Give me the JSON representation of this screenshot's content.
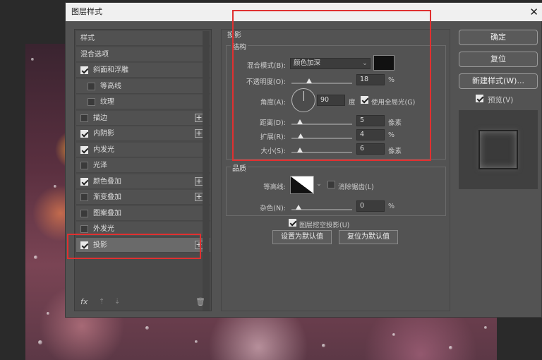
{
  "dialog": {
    "title": "图层样式",
    "close_symbol": "✕"
  },
  "left_panel": {
    "items": [
      {
        "label": "样式",
        "checkbox": false,
        "checked": false,
        "sub": false,
        "plus": false,
        "selected": false
      },
      {
        "label": "混合选项",
        "checkbox": false,
        "checked": false,
        "sub": false,
        "plus": false,
        "selected": false
      },
      {
        "label": "斜面和浮雕",
        "checkbox": true,
        "checked": true,
        "sub": false,
        "plus": false,
        "selected": false
      },
      {
        "label": "等高线",
        "checkbox": true,
        "checked": false,
        "sub": true,
        "plus": false,
        "selected": false
      },
      {
        "label": "纹理",
        "checkbox": true,
        "checked": false,
        "sub": true,
        "plus": false,
        "selected": false
      },
      {
        "label": "描边",
        "checkbox": true,
        "checked": false,
        "sub": false,
        "plus": true,
        "selected": false
      },
      {
        "label": "内阴影",
        "checkbox": true,
        "checked": true,
        "sub": false,
        "plus": true,
        "selected": false
      },
      {
        "label": "内发光",
        "checkbox": true,
        "checked": true,
        "sub": false,
        "plus": false,
        "selected": false
      },
      {
        "label": "光泽",
        "checkbox": true,
        "checked": false,
        "sub": false,
        "plus": false,
        "selected": false
      },
      {
        "label": "颜色叠加",
        "checkbox": true,
        "checked": true,
        "sub": false,
        "plus": true,
        "selected": false
      },
      {
        "label": "渐变叠加",
        "checkbox": true,
        "checked": false,
        "sub": false,
        "plus": true,
        "selected": false
      },
      {
        "label": "图案叠加",
        "checkbox": true,
        "checked": false,
        "sub": false,
        "plus": false,
        "selected": false
      },
      {
        "label": "外发光",
        "checkbox": true,
        "checked": false,
        "sub": false,
        "plus": false,
        "selected": false
      },
      {
        "label": "投影",
        "checkbox": true,
        "checked": true,
        "sub": false,
        "plus": true,
        "selected": true
      }
    ],
    "plus_symbol": "+",
    "fx_label": "fx",
    "up_symbol": "⇡",
    "down_symbol": "⇣",
    "trash_symbol": "🗑"
  },
  "drop_shadow": {
    "section_title": "投影",
    "structure_title": "结构",
    "blend_mode_label": "混合模式(B):",
    "blend_mode_value": "颜色加深",
    "shadow_color": "#111111",
    "opacity_label": "不透明度(O):",
    "opacity_value": "18",
    "opacity_fraction": 0.18,
    "percent": "%",
    "angle_label": "角度(A):",
    "angle_value": "90",
    "degree_unit": "度",
    "global_light_label": "使用全局光(G)",
    "global_light_checked": true,
    "distance_label": "距离(D):",
    "distance_value": "5",
    "distance_fraction": 0.02,
    "spread_label": "扩展(R):",
    "spread_value": "4",
    "spread_fraction": 0.04,
    "size_label": "大小(S):",
    "size_value": "6",
    "size_fraction": 0.02,
    "pixel_unit": "像素",
    "quality_title": "品质",
    "contour_label": "等高线:",
    "antialias_label": "消除锯齿(L)",
    "antialias_checked": false,
    "noise_label": "杂色(N):",
    "noise_value": "0",
    "noise_fraction": 0,
    "knockout_label": "图层挖空投影(U)",
    "knockout_checked": true,
    "set_default_label": "设置为默认值",
    "reset_default_label": "复位为默认值"
  },
  "right_panel": {
    "ok_label": "确定",
    "reset_label": "复位",
    "new_style_label": "新建样式(W)...",
    "preview_label": "预览(V)",
    "preview_checked": true
  },
  "colors": {
    "highlight_red": "#e03030",
    "dialog_bg": "#535353"
  }
}
